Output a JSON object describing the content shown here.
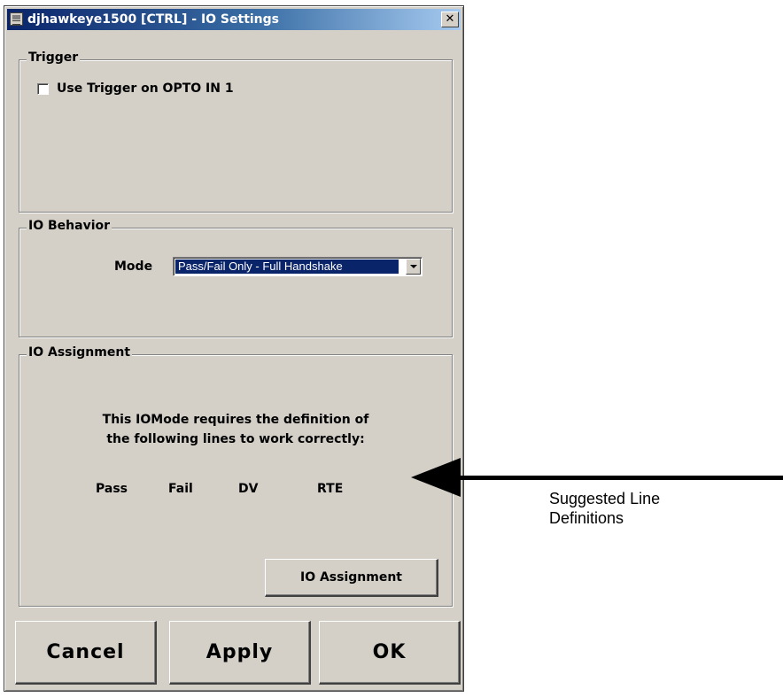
{
  "window": {
    "title": "djhawkeye1500 [CTRL] - IO Settings",
    "close_symbol": "✕"
  },
  "trigger": {
    "legend": "Trigger",
    "checkbox_label": "Use Trigger on OPTO IN 1",
    "checked": false
  },
  "io_behavior": {
    "legend": "IO Behavior",
    "mode_label": "Mode",
    "mode_value": "Pass/Fail Only - Full Handshake"
  },
  "io_assignment": {
    "legend": "IO Assignment",
    "requirement_line1": "This IOMode requires the definition of",
    "requirement_line2": "the following lines to work correctly:",
    "lines": [
      "Pass",
      "Fail",
      "DV",
      "RTE"
    ],
    "button_label": "IO Assignment"
  },
  "buttons": {
    "cancel": "Cancel",
    "apply": "Apply",
    "ok": "OK"
  },
  "annotation": {
    "line1": "Suggested Line",
    "line2": "Definitions"
  },
  "icons": {
    "title": "window-app-icon",
    "close": "close-icon",
    "dropdown": "chevron-down-icon",
    "arrow": "arrow-left-icon"
  }
}
